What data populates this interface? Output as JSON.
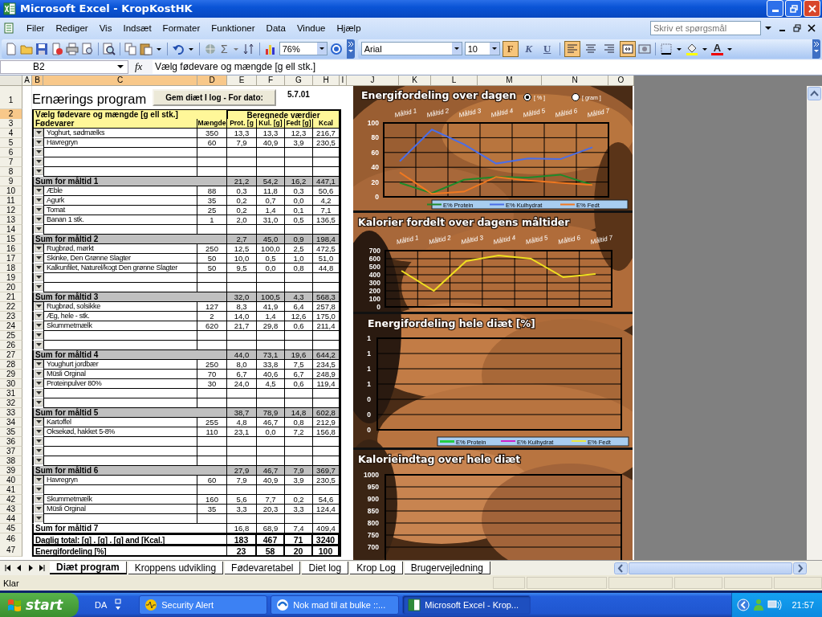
{
  "window": {
    "title": "Microsoft Excel - KropKostHK"
  },
  "menu": [
    "Filer",
    "Rediger",
    "Vis",
    "Indsæt",
    "Formater",
    "Funktioner",
    "Data",
    "Vindue",
    "Hjælp"
  ],
  "help_search": {
    "placeholder": "Skriv et spørgsmål"
  },
  "toolbar": {
    "autosum": "Σ",
    "zoom": "76%",
    "font": "Arial",
    "font_size": "10"
  },
  "formatting": [
    {
      "label": "F",
      "kind": "bold",
      "on": true
    },
    {
      "label": "K",
      "kind": "italic",
      "on": false
    },
    {
      "label": "U",
      "kind": "underline",
      "on": false
    }
  ],
  "alignment": [
    {
      "kind": "left",
      "on": true
    },
    {
      "kind": "center",
      "on": false
    },
    {
      "kind": "right",
      "on": false
    },
    {
      "kind": "merge",
      "on": true
    }
  ],
  "font_color_label": "A",
  "formula_bar": {
    "cell": "B2",
    "function_label": "fx",
    "formula": "Vælg fødevare og mængde [g ell stk.]"
  },
  "columns": [
    {
      "label": "A",
      "selected": false
    },
    {
      "label": "B",
      "selected": true
    },
    {
      "label": "C",
      "selected": true
    },
    {
      "label": "D",
      "selected": true
    },
    {
      "label": "E",
      "selected": false
    },
    {
      "label": "F",
      "selected": false
    },
    {
      "label": "G",
      "selected": false
    },
    {
      "label": "H",
      "selected": false
    },
    {
      "label": "I",
      "selected": false
    },
    {
      "label": "J",
      "selected": false
    },
    {
      "label": "K",
      "selected": false
    },
    {
      "label": "L",
      "selected": false
    },
    {
      "label": "M",
      "selected": false
    },
    {
      "label": "N",
      "selected": false
    },
    {
      "label": "O",
      "selected": false
    }
  ],
  "rows": [
    {
      "n": "1",
      "kind": "title",
      "selected": false,
      "title": "Ernærings program",
      "button": "Gem diæt I log - For dato:",
      "date": "5.7.01"
    },
    {
      "n": "2",
      "kind": "group_header",
      "selected": true,
      "left": "Vælg fødevare og mængde [g ell stk.]",
      "right": "Beregnede værdier"
    },
    {
      "n": "3",
      "kind": "column_header",
      "selected": false,
      "cells": [
        "Fødevarer",
        "Mængde",
        "Prot. [g",
        "Kul. [g]",
        "Fedt [g]",
        "Kcal"
      ]
    },
    {
      "n": "4",
      "kind": "item",
      "selected": false,
      "food": "Yoghurt, sødmælks",
      "amount": "350",
      "values": [
        "13,3",
        "13,3",
        "12,3",
        "216,7"
      ]
    },
    {
      "n": "5",
      "kind": "item",
      "selected": false,
      "food": "Havregryn",
      "amount": "60",
      "values": [
        "7,9",
        "40,9",
        "3,9",
        "230,5"
      ]
    },
    {
      "n": "6",
      "kind": "item",
      "selected": false
    },
    {
      "n": "7",
      "kind": "item",
      "selected": false
    },
    {
      "n": "8",
      "kind": "item",
      "selected": false
    },
    {
      "n": "9",
      "kind": "sum",
      "selected": false,
      "shaded": true,
      "label": "Sum for måltid 1",
      "values": [
        "21,2",
        "54,2",
        "16,2",
        "447,1"
      ]
    },
    {
      "n": "10",
      "kind": "item",
      "selected": false,
      "food": "Æble",
      "amount": "88",
      "values": [
        "0,3",
        "11,8",
        "0,3",
        "50,6"
      ]
    },
    {
      "n": "11",
      "kind": "item",
      "selected": false,
      "food": "Agurk",
      "amount": "35",
      "values": [
        "0,2",
        "0,7",
        "0,0",
        "4,2"
      ]
    },
    {
      "n": "12",
      "kind": "item",
      "selected": false,
      "food": "Tomat",
      "amount": "25",
      "values": [
        "0,2",
        "1,4",
        "0,1",
        "7,1"
      ]
    },
    {
      "n": "13",
      "kind": "item",
      "selected": false,
      "food": "Banan 1 stk.",
      "amount": "1",
      "values": [
        "2,0",
        "31,0",
        "0,5",
        "136,5"
      ]
    },
    {
      "n": "14",
      "kind": "item",
      "selected": false
    },
    {
      "n": "15",
      "kind": "sum",
      "selected": false,
      "shaded": true,
      "label": "Sum for måltid 2",
      "values": [
        "2,7",
        "45,0",
        "0,9",
        "198,4"
      ]
    },
    {
      "n": "16",
      "kind": "item",
      "selected": false,
      "food": "Rugbrød, mørkt",
      "amount": "250",
      "values": [
        "12,5",
        "100,0",
        "2,5",
        "472,5"
      ]
    },
    {
      "n": "17",
      "kind": "item",
      "selected": false,
      "food": "Skinke, Den Grønne Slagter",
      "amount": "50",
      "values": [
        "10,0",
        "0,5",
        "1,0",
        "51,0"
      ]
    },
    {
      "n": "18",
      "kind": "item",
      "selected": false,
      "food": "Kalkunfilet, Naturel/kogt Den grønne Slagter",
      "amount": "50",
      "values": [
        "9,5",
        "0,0",
        "0,8",
        "44,8"
      ]
    },
    {
      "n": "19",
      "kind": "item",
      "selected": false
    },
    {
      "n": "20",
      "kind": "item",
      "selected": false
    },
    {
      "n": "21",
      "kind": "sum",
      "selected": false,
      "shaded": true,
      "label": "Sum for måltid 3",
      "values": [
        "32,0",
        "100,5",
        "4,3",
        "568,3"
      ]
    },
    {
      "n": "22",
      "kind": "item",
      "selected": false,
      "food": "Rugbrød, solsikke",
      "amount": "127",
      "values": [
        "8,3",
        "41,9",
        "6,4",
        "257,8"
      ]
    },
    {
      "n": "23",
      "kind": "item",
      "selected": false,
      "food": "Æg, hele - stk.",
      "amount": "2",
      "values": [
        "14,0",
        "1,4",
        "12,6",
        "175,0"
      ]
    },
    {
      "n": "24",
      "kind": "item",
      "selected": false,
      "food": "Skummetmælk",
      "amount": "620",
      "values": [
        "21,7",
        "29,8",
        "0,6",
        "211,4"
      ]
    },
    {
      "n": "25",
      "kind": "item",
      "selected": false
    },
    {
      "n": "26",
      "kind": "item",
      "selected": false
    },
    {
      "n": "27",
      "kind": "sum",
      "selected": false,
      "shaded": true,
      "label": "Sum for måltid 4",
      "values": [
        "44,0",
        "73,1",
        "19,6",
        "644,2"
      ]
    },
    {
      "n": "28",
      "kind": "item",
      "selected": false,
      "food": "Youghurt jordbær",
      "amount": "250",
      "values": [
        "8,0",
        "33,8",
        "7,5",
        "234,5"
      ]
    },
    {
      "n": "29",
      "kind": "item",
      "selected": false,
      "food": "Müsli Orginal",
      "amount": "70",
      "values": [
        "6,7",
        "40,6",
        "6,7",
        "248,9"
      ]
    },
    {
      "n": "30",
      "kind": "item",
      "selected": false,
      "food": "Proteinpulver 80%",
      "amount": "30",
      "values": [
        "24,0",
        "4,5",
        "0,6",
        "119,4"
      ]
    },
    {
      "n": "31",
      "kind": "item",
      "selected": false
    },
    {
      "n": "32",
      "kind": "item",
      "selected": false
    },
    {
      "n": "33",
      "kind": "sum",
      "selected": false,
      "shaded": true,
      "label": "Sum for måltid 5",
      "values": [
        "38,7",
        "78,9",
        "14,8",
        "602,8"
      ]
    },
    {
      "n": "34",
      "kind": "item",
      "selected": false,
      "food": "Kartoffel",
      "amount": "255",
      "values": [
        "4,8",
        "46,7",
        "0,8",
        "212,9"
      ]
    },
    {
      "n": "35",
      "kind": "item",
      "selected": false,
      "food": "Oksekød, hakket 5-8%",
      "amount": "110",
      "values": [
        "23,1",
        "0,0",
        "7,2",
        "156,8"
      ]
    },
    {
      "n": "36",
      "kind": "item",
      "selected": false
    },
    {
      "n": "37",
      "kind": "item",
      "selected": false
    },
    {
      "n": "38",
      "kind": "item",
      "selected": false
    },
    {
      "n": "39",
      "kind": "sum",
      "selected": false,
      "shaded": true,
      "label": "Sum for måltid 6",
      "values": [
        "27,9",
        "46,7",
        "7,9",
        "369,7"
      ]
    },
    {
      "n": "40",
      "kind": "item",
      "selected": false,
      "food": "Havregryn",
      "amount": "60",
      "values": [
        "7,9",
        "40,9",
        "3,9",
        "230,5"
      ]
    },
    {
      "n": "41",
      "kind": "item",
      "selected": false
    },
    {
      "n": "42",
      "kind": "item",
      "selected": false,
      "food": "Skummetmælk",
      "amount": "160",
      "values": [
        "5,6",
        "7,7",
        "0,2",
        "54,6"
      ]
    },
    {
      "n": "43",
      "kind": "item",
      "selected": false,
      "food": "Müsli Orginal",
      "amount": "35",
      "values": [
        "3,3",
        "20,3",
        "3,3",
        "124,4"
      ]
    },
    {
      "n": "44",
      "kind": "item",
      "selected": false
    },
    {
      "n": "45",
      "kind": "sum",
      "selected": false,
      "shaded": false,
      "label": "Sum for måltid 7",
      "values": [
        "16,8",
        "68,9",
        "7,4",
        "409,4"
      ]
    },
    {
      "n": "46",
      "kind": "total",
      "selected": false,
      "label": "Daglig total: [g] . [g] . [g] and [Kcal.]",
      "values": [
        "183",
        "467",
        "71",
        "3240"
      ]
    },
    {
      "n": "47",
      "kind": "total",
      "selected": false,
      "label": "Energifordeling [%]",
      "values": [
        "23",
        "58",
        "20",
        "100"
      ]
    }
  ],
  "charts": [
    {
      "options": [
        {
          "label": "[ % ]",
          "selected": true
        },
        {
          "label": "[ gram ]",
          "selected": false
        }
      ],
      "chart_data": {
        "type": "line",
        "title": "Energifordeling over dagen",
        "categories": [
          "Måltid 1",
          "Måltid 2",
          "Måltid 3",
          "Måltid 4",
          "Måltid 5",
          "Måltid 6",
          "Måltid 7"
        ],
        "ylim": [
          0,
          100
        ],
        "yticks": [
          0,
          20,
          40,
          60,
          80,
          100
        ],
        "grid": true,
        "legend": "bottom",
        "series": [
          {
            "name": "E% Protein",
            "color": "#1f8a2a",
            "values": [
              19,
              5,
              23,
              27,
              26,
              30,
              16
            ]
          },
          {
            "name": "E% Kulhydrat",
            "color": "#4a6ee8",
            "values": [
              48,
              91,
              71,
              45,
              52,
              51,
              67
            ]
          },
          {
            "name": "E% Fedt",
            "color": "#f07820",
            "values": [
              33,
              4,
              7,
              27,
              22,
              19,
              16
            ]
          }
        ]
      }
    },
    {
      "chart_data": {
        "type": "line",
        "title": "Kalorier fordelt over dagens måltider",
        "categories": [
          "Måltid 1",
          "Måltid 2",
          "Måltid 3",
          "Måltid 4",
          "Måltid 5",
          "Måltid 6",
          "Måltid 7"
        ],
        "ylim": [
          0,
          700
        ],
        "yticks": [
          0,
          100,
          200,
          300,
          400,
          500,
          600,
          700
        ],
        "grid": true,
        "series": [
          {
            "color": "#f0e020",
            "values": [
              450,
              200,
              570,
              640,
              600,
              370,
              410
            ]
          }
        ]
      }
    }
  ],
  "empty_charts": [
    {
      "title": "Energifordeling hele diæt [%]",
      "y_labels": [
        "1",
        "1",
        "1",
        "1",
        "0",
        "0",
        "0"
      ],
      "legend": [
        {
          "name": "E% Protein",
          "color": "#22cc44"
        },
        {
          "name": "E% Kulhydrat",
          "color": "#cc22cc"
        },
        {
          "name": "E% Fedt",
          "color": "#e8e840"
        }
      ]
    },
    {
      "title": "Kalorieindtag over hele diæt",
      "y_labels": [
        "1000",
        "950",
        "900",
        "850",
        "800",
        "750",
        "700"
      ]
    }
  ],
  "sheet_tabs": [
    {
      "label": "Diæt program",
      "selected": true
    },
    {
      "label": "Kroppens udvikling",
      "selected": false
    },
    {
      "label": "Fødevaretabel",
      "selected": false
    },
    {
      "label": "Diet log",
      "selected": false
    },
    {
      "label": "Krop Log",
      "selected": false
    },
    {
      "label": "Brugervejledning",
      "selected": false
    }
  ],
  "status": "Klar",
  "taskbar": {
    "start": "start",
    "language": "DA",
    "tasks": [
      {
        "label": "Security Alert",
        "selected": false
      },
      {
        "label": "Nok mad til at bulke ::...",
        "selected": false
      },
      {
        "label": "Microsoft Excel - Krop...",
        "selected": true
      }
    ],
    "clock": "21:57"
  }
}
